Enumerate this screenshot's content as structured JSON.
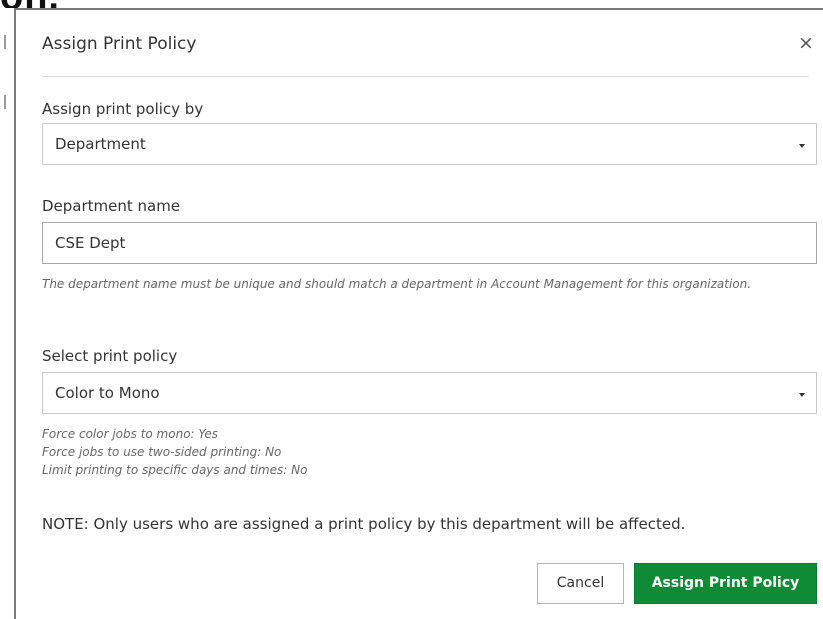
{
  "background": {
    "fragment_text": "on."
  },
  "modal": {
    "title": "Assign Print Policy",
    "close_symbol": "×",
    "assign_by": {
      "label": "Assign print policy by",
      "selected": "Department"
    },
    "department": {
      "label": "Department name",
      "value": "CSE Dept",
      "help": "The department name must be unique and should match a department in Account Management for this organization."
    },
    "policy": {
      "label": "Select print policy",
      "selected": "Color to Mono",
      "details": [
        "Force color jobs to mono: Yes",
        "Force jobs to use two-sided printing: No",
        "Limit printing to specific days and times: No"
      ]
    },
    "note": "NOTE: Only users who are assigned a print policy by this department will be affected.",
    "buttons": {
      "cancel": "Cancel",
      "submit": "Assign Print Policy"
    }
  },
  "colors": {
    "primary_button": "#0f8a35",
    "primary_text": "#ffffff",
    "border": "#c9c9c9",
    "help_text": "#666666"
  }
}
